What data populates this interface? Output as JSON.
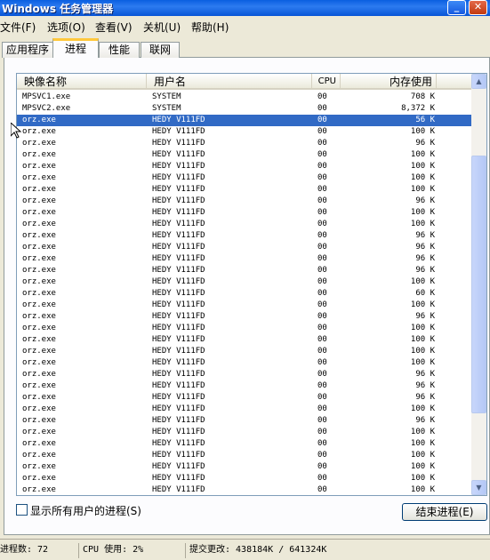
{
  "window": {
    "title": "Windows 任务管理器",
    "minimize_glyph": "_",
    "close_glyph": "✕"
  },
  "menu": [
    "文件(F)",
    "选项(O)",
    "查看(V)",
    "关机(U)",
    "帮助(H)"
  ],
  "tabs": [
    {
      "label": "应用程序"
    },
    {
      "label": "进程"
    },
    {
      "label": "性能"
    },
    {
      "label": "联网"
    }
  ],
  "active_tab": "进程",
  "columns": {
    "name": "映像名称",
    "user": "用户名",
    "cpu": "CPU",
    "mem": "内存使用"
  },
  "processes": [
    {
      "name": "MPSVC1.exe",
      "user": "SYSTEM",
      "cpu": "00",
      "mem": "708 K"
    },
    {
      "name": "MPSVC2.exe",
      "user": "SYSTEM",
      "cpu": "00",
      "mem": "8,372 K"
    },
    {
      "name": "orz.exe",
      "user": "HEDY V111FD",
      "cpu": "00",
      "mem": "56 K",
      "selected": true
    },
    {
      "name": "orz.exe",
      "user": "HEDY V111FD",
      "cpu": "00",
      "mem": "100 K"
    },
    {
      "name": "orz.exe",
      "user": "HEDY V111FD",
      "cpu": "00",
      "mem": "96 K"
    },
    {
      "name": "orz.exe",
      "user": "HEDY V111FD",
      "cpu": "00",
      "mem": "100 K"
    },
    {
      "name": "orz.exe",
      "user": "HEDY V111FD",
      "cpu": "00",
      "mem": "100 K"
    },
    {
      "name": "orz.exe",
      "user": "HEDY V111FD",
      "cpu": "00",
      "mem": "100 K"
    },
    {
      "name": "orz.exe",
      "user": "HEDY V111FD",
      "cpu": "00",
      "mem": "100 K"
    },
    {
      "name": "orz.exe",
      "user": "HEDY V111FD",
      "cpu": "00",
      "mem": "96 K"
    },
    {
      "name": "orz.exe",
      "user": "HEDY V111FD",
      "cpu": "00",
      "mem": "100 K"
    },
    {
      "name": "orz.exe",
      "user": "HEDY V111FD",
      "cpu": "00",
      "mem": "100 K"
    },
    {
      "name": "orz.exe",
      "user": "HEDY V111FD",
      "cpu": "00",
      "mem": "96 K"
    },
    {
      "name": "orz.exe",
      "user": "HEDY V111FD",
      "cpu": "00",
      "mem": "96 K"
    },
    {
      "name": "orz.exe",
      "user": "HEDY V111FD",
      "cpu": "00",
      "mem": "96 K"
    },
    {
      "name": "orz.exe",
      "user": "HEDY V111FD",
      "cpu": "00",
      "mem": "96 K"
    },
    {
      "name": "orz.exe",
      "user": "HEDY V111FD",
      "cpu": "00",
      "mem": "100 K"
    },
    {
      "name": "orz.exe",
      "user": "HEDY V111FD",
      "cpu": "00",
      "mem": "60 K"
    },
    {
      "name": "orz.exe",
      "user": "HEDY V111FD",
      "cpu": "00",
      "mem": "100 K"
    },
    {
      "name": "orz.exe",
      "user": "HEDY V111FD",
      "cpu": "00",
      "mem": "96 K"
    },
    {
      "name": "orz.exe",
      "user": "HEDY V111FD",
      "cpu": "00",
      "mem": "100 K"
    },
    {
      "name": "orz.exe",
      "user": "HEDY V111FD",
      "cpu": "00",
      "mem": "100 K"
    },
    {
      "name": "orz.exe",
      "user": "HEDY V111FD",
      "cpu": "00",
      "mem": "100 K"
    },
    {
      "name": "orz.exe",
      "user": "HEDY V111FD",
      "cpu": "00",
      "mem": "100 K"
    },
    {
      "name": "orz.exe",
      "user": "HEDY V111FD",
      "cpu": "00",
      "mem": "96 K"
    },
    {
      "name": "orz.exe",
      "user": "HEDY V111FD",
      "cpu": "00",
      "mem": "96 K"
    },
    {
      "name": "orz.exe",
      "user": "HEDY V111FD",
      "cpu": "00",
      "mem": "96 K"
    },
    {
      "name": "orz.exe",
      "user": "HEDY V111FD",
      "cpu": "00",
      "mem": "100 K"
    },
    {
      "name": "orz.exe",
      "user": "HEDY V111FD",
      "cpu": "00",
      "mem": "96 K"
    },
    {
      "name": "orz.exe",
      "user": "HEDY V111FD",
      "cpu": "00",
      "mem": "100 K"
    },
    {
      "name": "orz.exe",
      "user": "HEDY V111FD",
      "cpu": "00",
      "mem": "100 K"
    },
    {
      "name": "orz.exe",
      "user": "HEDY V111FD",
      "cpu": "00",
      "mem": "100 K"
    },
    {
      "name": "orz.exe",
      "user": "HEDY V111FD",
      "cpu": "00",
      "mem": "100 K"
    },
    {
      "name": "orz.exe",
      "user": "HEDY V111FD",
      "cpu": "00",
      "mem": "100 K"
    },
    {
      "name": "orz.exe",
      "user": "HEDY V111FD",
      "cpu": "00",
      "mem": "100 K"
    },
    {
      "name": "orz.exe",
      "user": "HEDY V111FD",
      "cpu": "00",
      "mem": "100 K"
    }
  ],
  "show_all_users": {
    "label": "显示所有用户的进程(S)",
    "checked": false
  },
  "end_process_button": "结束进程(E)",
  "status": {
    "processes": "进程数: 72",
    "cpu": "CPU 使用: 2%",
    "commit": "提交更改: 438184K / 641324K"
  },
  "colors": {
    "selection": "#316AC5",
    "titlebar": "#0A5FE0",
    "window_bg": "#ECE9D8"
  },
  "icons": {
    "minimize": "minimize-icon",
    "close": "close-icon",
    "scroll_up": "scroll-up-icon",
    "scroll_down": "scroll-down-icon",
    "cursor": "mouse-pointer-icon"
  }
}
